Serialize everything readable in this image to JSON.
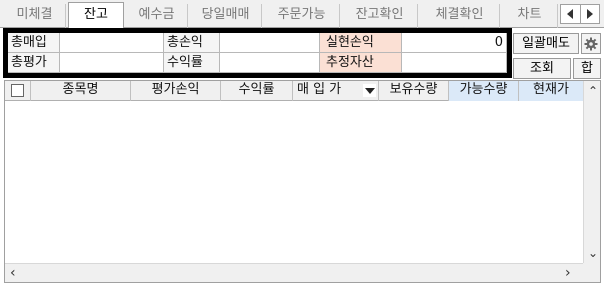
{
  "tabs": [
    {
      "label": "미체결",
      "active": false
    },
    {
      "label": "잔고",
      "active": true
    },
    {
      "label": "예수금",
      "active": false
    },
    {
      "label": "당일매매",
      "active": false
    },
    {
      "label": "주문가능",
      "active": false
    },
    {
      "label": "잔고확인",
      "active": false
    },
    {
      "label": "체결확인",
      "active": false
    },
    {
      "label": "차트",
      "active": false
    }
  ],
  "summary": {
    "total_buy_label": "총매입",
    "total_buy_value": "",
    "total_pnl_label": "총손익",
    "total_pnl_value": "",
    "realized_pnl_label": "실현손익",
    "realized_pnl_value": "0",
    "total_eval_label": "총평가",
    "total_eval_value": "",
    "return_label": "수익률",
    "return_value": "",
    "est_assets_label": "추정자산",
    "est_assets_value": ""
  },
  "buttons": {
    "bulk_sell": "일괄매도",
    "query": "조회",
    "sum": "합"
  },
  "grid": {
    "columns": [
      "종목명",
      "평가손익",
      "수익률",
      "매 입 가",
      "보유수량",
      "가능수량",
      "현재가"
    ],
    "rows": []
  },
  "colors": {
    "highlight_label_bg": "#fbe0d4",
    "blue_header_bg": "#dbe9f8",
    "box_border": "#000000"
  }
}
